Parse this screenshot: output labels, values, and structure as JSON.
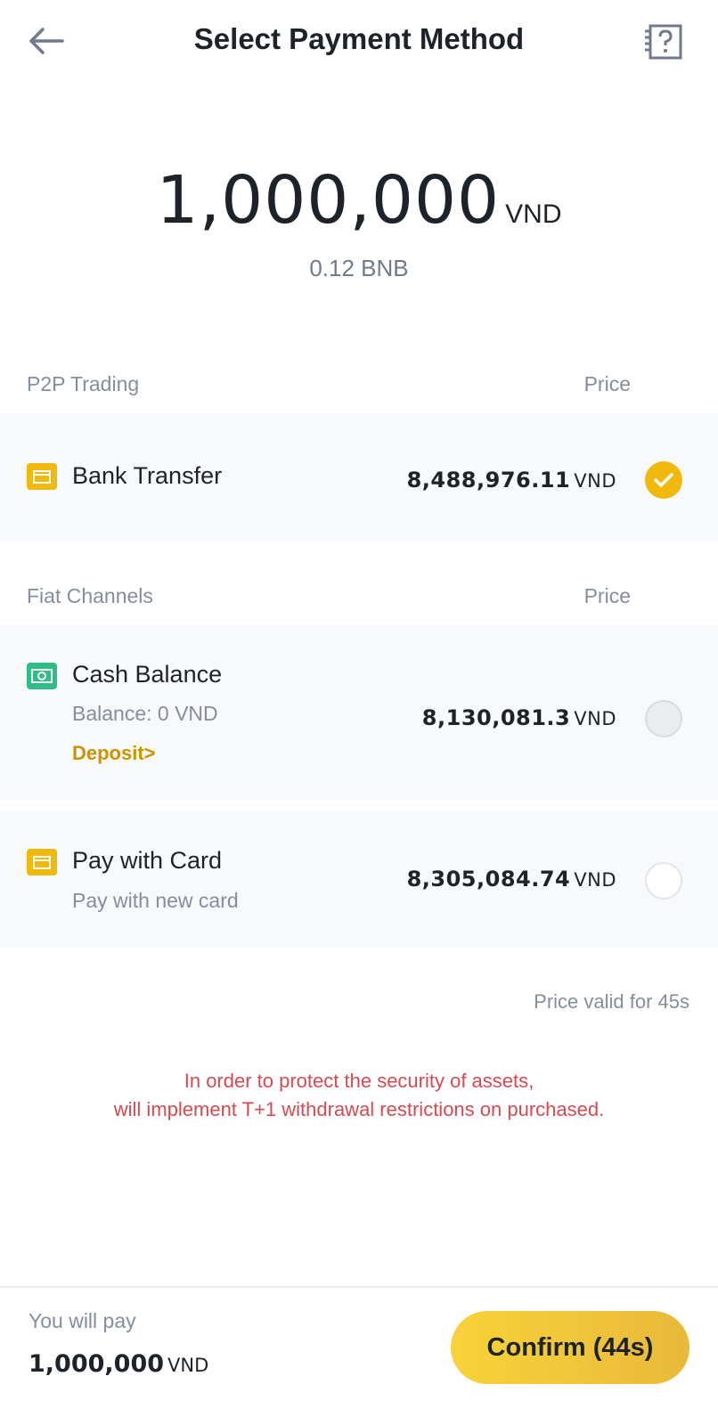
{
  "header": {
    "title": "Select Payment Method"
  },
  "amount": {
    "value": "1,000,000",
    "unit": "VND",
    "crypto": "0.12 BNB"
  },
  "p2p": {
    "label": "P2P Trading",
    "price_label": "Price",
    "methods": [
      {
        "name": "Bank Transfer",
        "price": "8,488,976.11",
        "unit": "VND",
        "selected": true,
        "icon": "bank-card-icon"
      }
    ]
  },
  "fiat": {
    "label": "Fiat Channels",
    "price_label": "Price",
    "methods": [
      {
        "name": "Cash Balance",
        "balance": "Balance:  0 VND",
        "link": "Deposit>",
        "price": "8,130,081.3",
        "unit": "VND",
        "selected": false,
        "icon": "cash-icon"
      },
      {
        "name": "Pay with Card",
        "sub": "Pay with new card",
        "price": "8,305,084.74",
        "unit": "VND",
        "selected": false,
        "icon": "credit-card-icon"
      }
    ]
  },
  "valid_text": "Price valid for 45s",
  "notice": {
    "line1": "In order to protect the security of assets,",
    "line2": "will implement T+1 withdrawal restrictions on purchased."
  },
  "footer": {
    "pay_label": "You will pay",
    "pay_amount": "1,000,000",
    "pay_unit": "VND",
    "confirm_label": "Confirm (44s)"
  },
  "colors": {
    "accent": "#f0b90b",
    "notice": "#d64a50",
    "cash_icon": "#2ebd85"
  }
}
